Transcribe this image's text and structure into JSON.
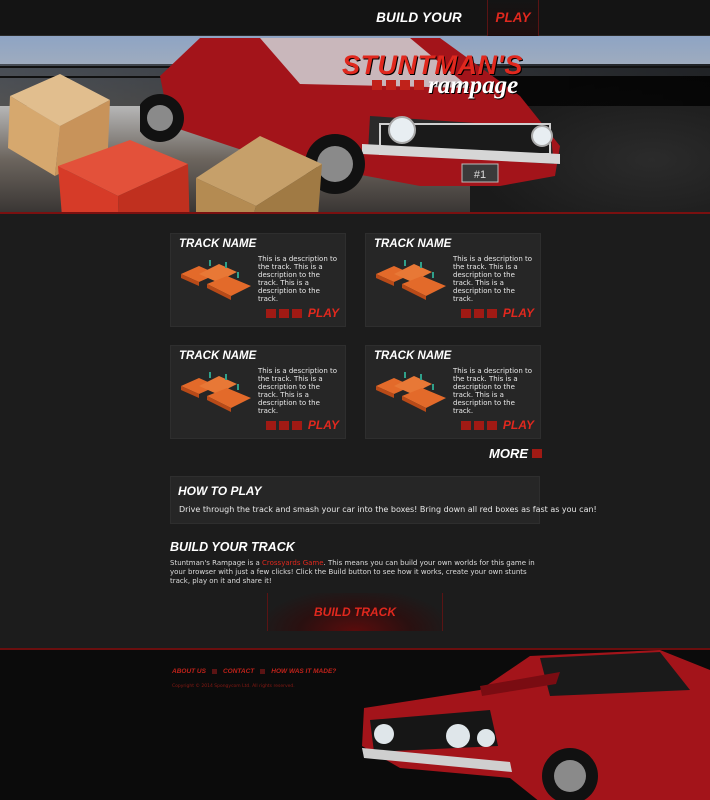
{
  "nav": {
    "build_label": "BUILD YOUR TRACK",
    "play_label": "PLAY"
  },
  "hero": {
    "logo_line1": "STUNTMAN'S",
    "logo_line2": "rampage",
    "plate_text": "#1"
  },
  "tracks": [
    {
      "title": "TRACK NAME",
      "description": "This is a description to the track. This is a description to the track. This is a description to the track.",
      "play_label": "PLAY"
    },
    {
      "title": "TRACK NAME",
      "description": "This is a description to the track. This is a description to the track. This is a description to the track.",
      "play_label": "PLAY"
    },
    {
      "title": "TRACK NAME",
      "description": "This is a description to the track. This is a description to the track. This is a description to the track.",
      "play_label": "PLAY"
    },
    {
      "title": "TRACK NAME",
      "description": "This is a description to the track. This is a description to the track. This is a description to the track.",
      "play_label": "PLAY"
    }
  ],
  "more_label": "MORE",
  "howto": {
    "title": "HOW TO PLAY",
    "text": "Drive through the track and smash your car into the boxes! Bring down all red boxes as fast as you can!"
  },
  "build": {
    "title": "BUILD YOUR TRACK",
    "text_before": "Stuntman's Rampage is a ",
    "link_text": "Crossyards Game",
    "text_after": ". This means you can build your own worlds for this game in your browser with just a few clicks! Click the Build button to see how it works, create your own stunts track, play on it and share it!",
    "button_label": "BUILD TRACK"
  },
  "footer": {
    "links": [
      "ABOUT US",
      "CONTACT",
      "HOW WAS IT MADE?"
    ],
    "copyright": "Copyright © 2014 Spongycom Ltd. All rights reserved."
  },
  "colors": {
    "accent": "#e0281e",
    "accent_dark": "#a01a14",
    "background": "#1c1c1c",
    "card": "#262626"
  }
}
